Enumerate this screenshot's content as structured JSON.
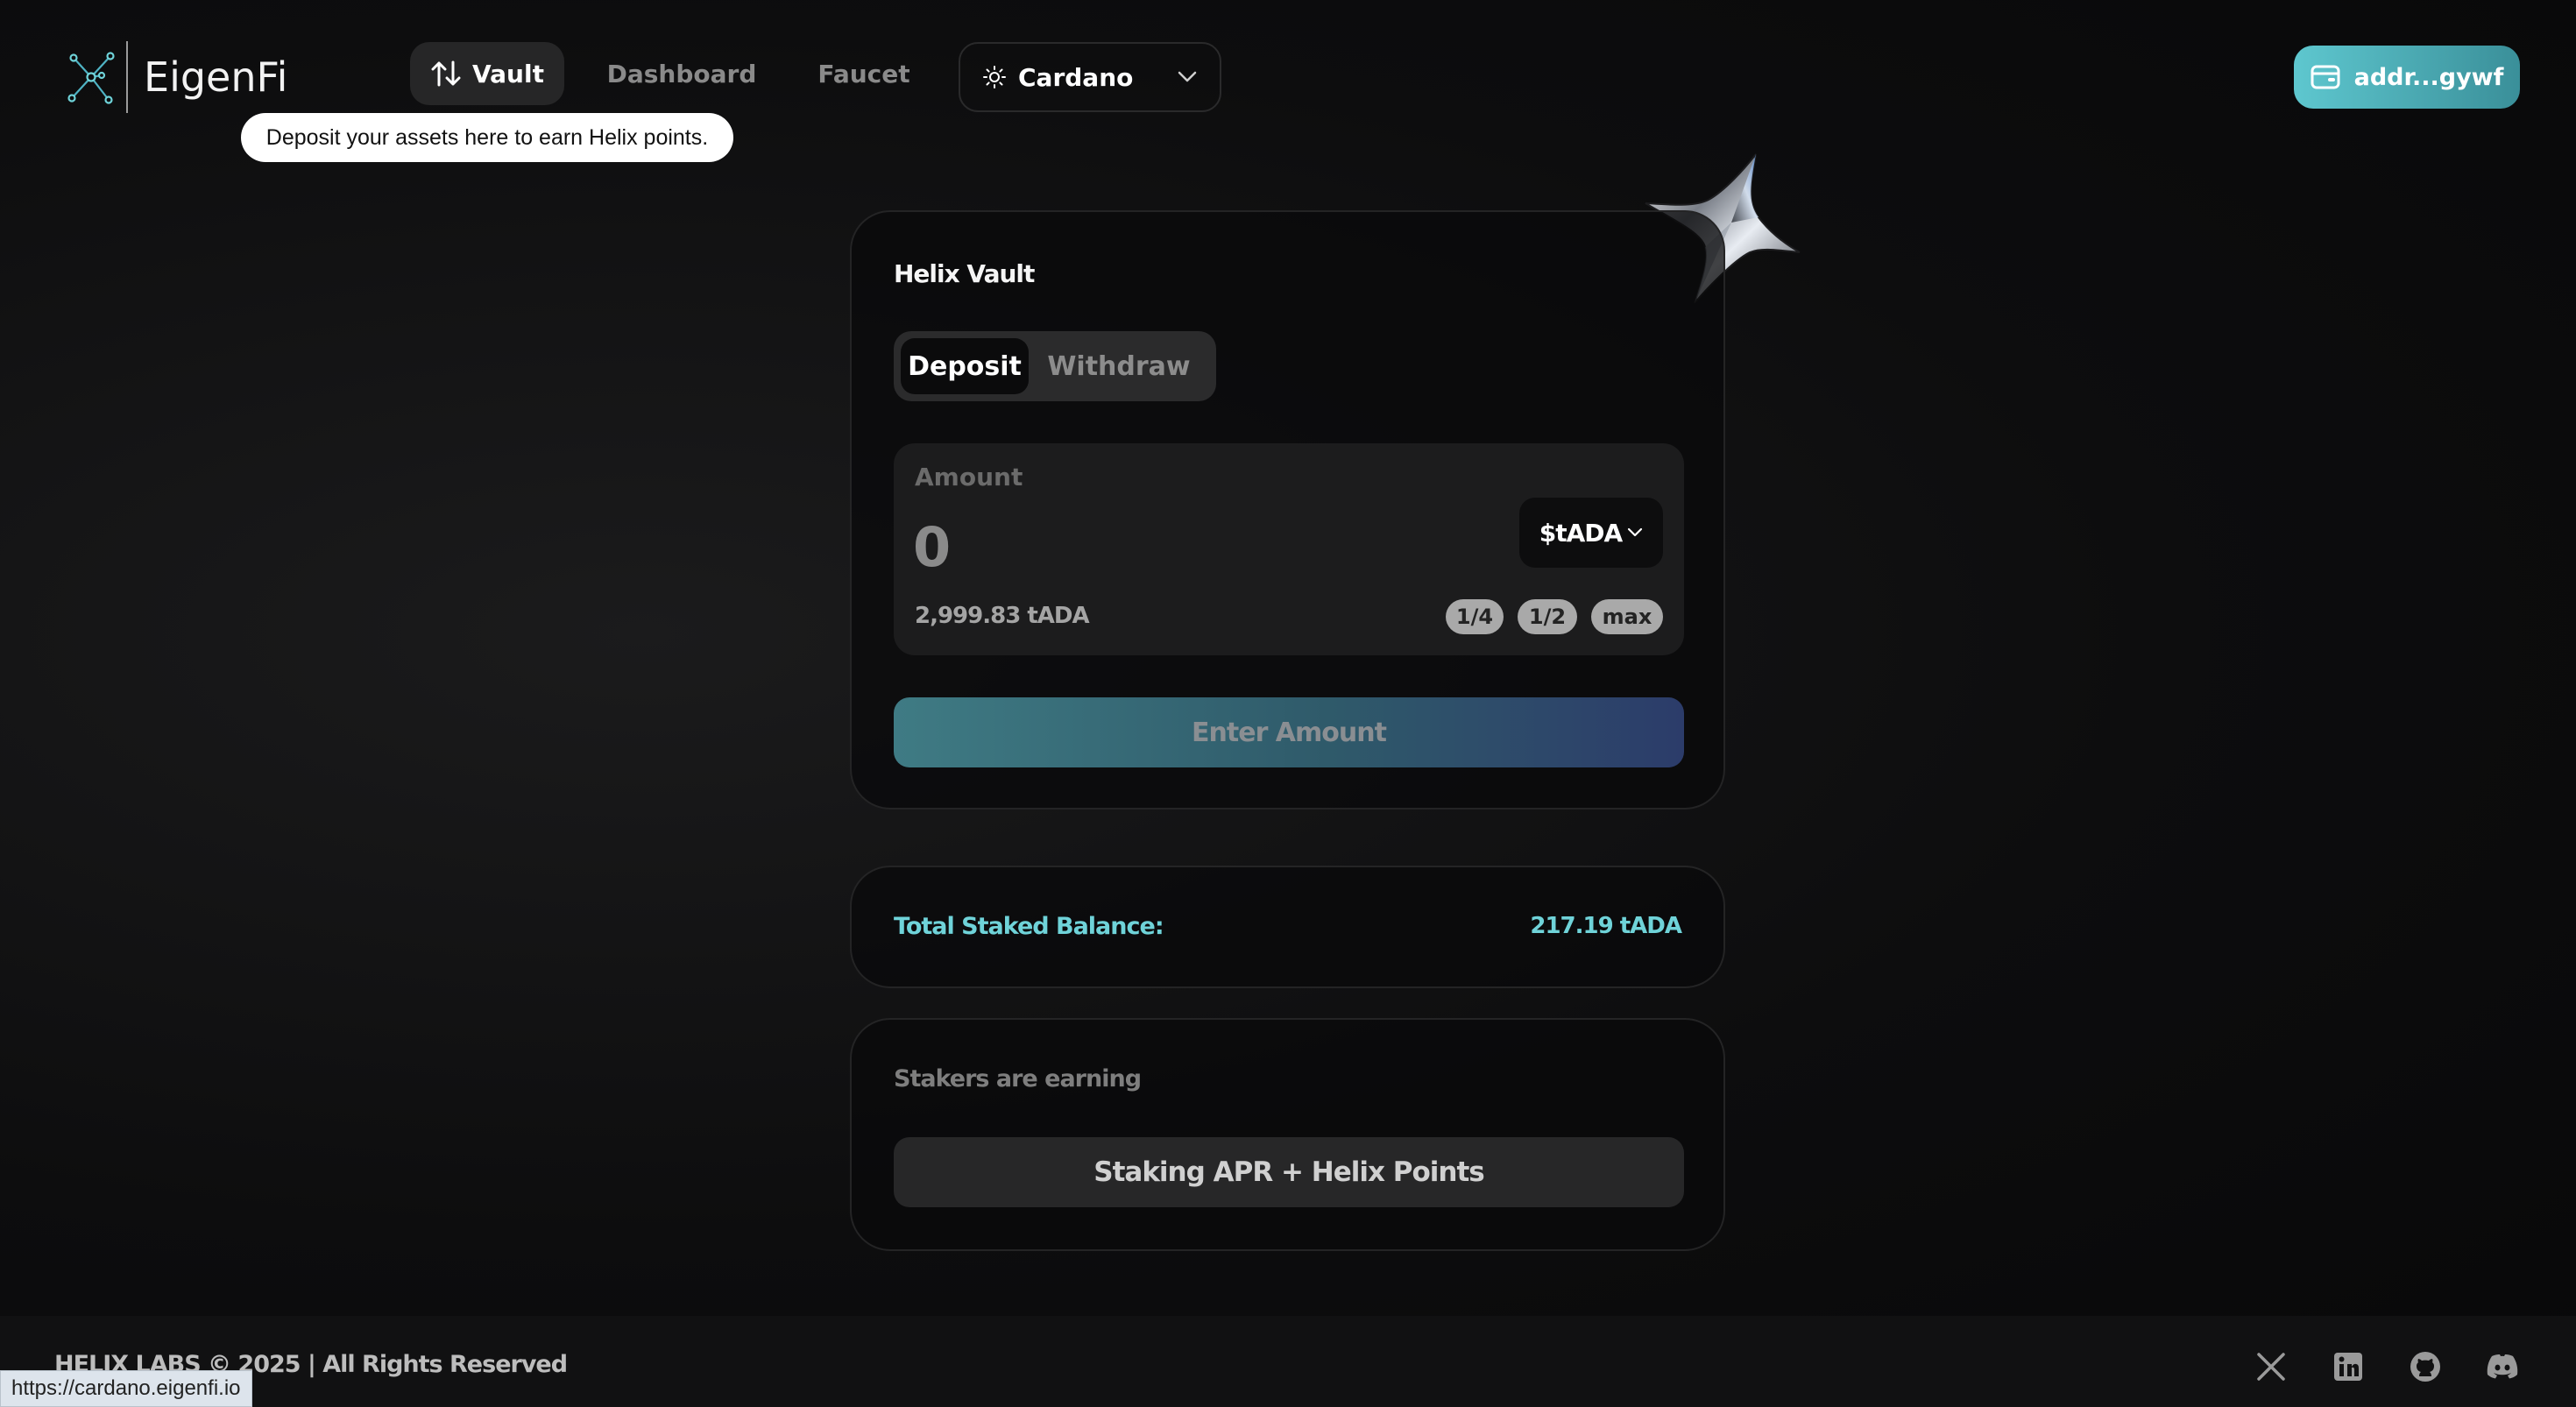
{
  "header": {
    "logo_text": "EigenFi",
    "nav": {
      "vault": "Vault",
      "dashboard": "Dashboard",
      "faucet": "Faucet"
    },
    "network": {
      "selected": "Cardano",
      "icon": "sun-icon"
    },
    "wallet": {
      "label": "addr...gywf",
      "icon": "wallet-icon"
    }
  },
  "tooltip": "Deposit your assets here to earn Helix points.",
  "vault": {
    "title": "Helix Vault",
    "tabs": [
      "Deposit",
      "Withdraw"
    ],
    "active_tab": "Deposit",
    "amount_label": "Amount",
    "amount_value": "0",
    "token": "$tADA",
    "available": "2,999.83 tADA",
    "quick": [
      "1/4",
      "1/2",
      "max"
    ],
    "submit_label": "Enter Amount"
  },
  "balance": {
    "label": "Total Staked Balance:",
    "value": "217.19 tADA"
  },
  "earning": {
    "label": "Stakers are earning",
    "value": "Staking APR + Helix Points"
  },
  "footer": {
    "copyright": "HELIX LABS © 2025  | All Rights Reserved",
    "social": [
      "x-icon",
      "linkedin-icon",
      "github-icon",
      "discord-icon"
    ]
  },
  "status_url": "https://cardano.eigenfi.io",
  "colors": {
    "accent": "#6fd3d9",
    "wallet_gradient_start": "#5ec7cf",
    "wallet_gradient_end": "#3a8f99",
    "background": "#0d0d0e"
  }
}
